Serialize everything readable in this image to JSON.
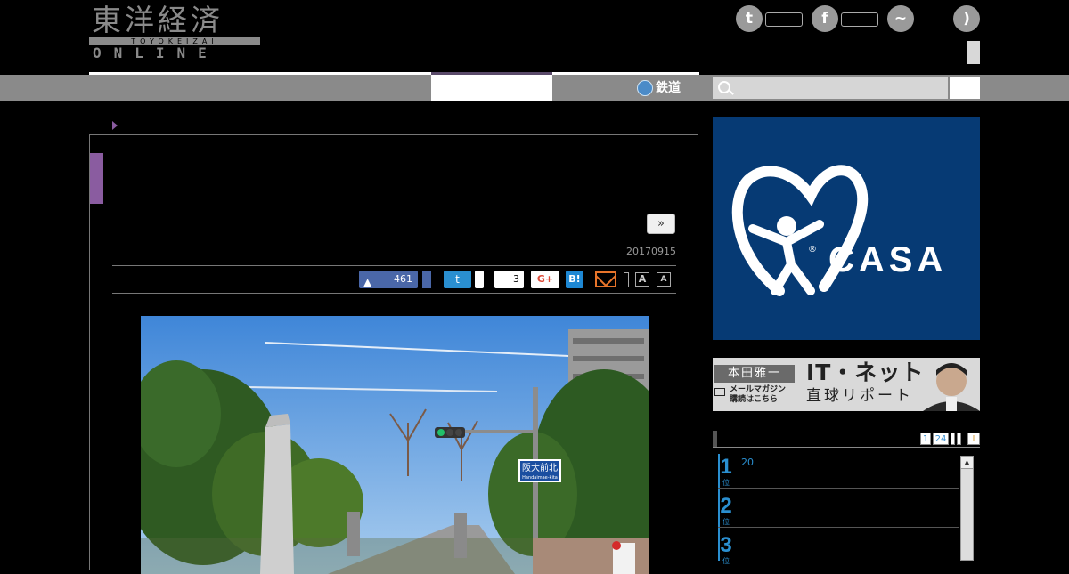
{
  "header": {
    "logo_main": "東洋経済",
    "logo_roman": "TOYOKEIZAI",
    "logo_sub": "ONLINE"
  },
  "social_top": [
    {
      "icon": "twitter-icon",
      "glyph": "t"
    },
    {
      "icon": "facebook-icon",
      "glyph": "f"
    },
    {
      "icon": "messenger-icon",
      "glyph": "~"
    },
    {
      "icon": "rss-icon",
      "glyph": ")"
    }
  ],
  "nav": {
    "railway_label": "鉄道",
    "search_placeholder": ""
  },
  "article": {
    "next_label": "»",
    "date": "20170915",
    "share": {
      "like_count": "461",
      "hatena_count": "3",
      "gplus_label": "G+",
      "hatena_label": "B!",
      "twitter_glyph": "t",
      "font_large": "A",
      "font_small": "A"
    },
    "photo": {
      "signpost_text": "阪大前北",
      "signpost_sub": "Handaimae-kita"
    }
  },
  "sidebar": {
    "ad": {
      "brand": "CASA",
      "reg": "®"
    },
    "banner": {
      "name": "本田雅一",
      "mail_line1": "メールマガジン",
      "mail_line2": "購読はこちら",
      "title": "IT・ネット",
      "subtitle": "直球リポート"
    },
    "ranking": {
      "tabs": [
        "1",
        "24",
        "",
        "",
        "I"
      ],
      "items": [
        {
          "rank": "1",
          "unit": "位",
          "text": "20"
        },
        {
          "rank": "2",
          "unit": "位",
          "text": ""
        },
        {
          "rank": "3",
          "unit": "位",
          "text": ""
        }
      ]
    }
  },
  "colors": {
    "nav_gray": "#8a8a8a",
    "accent_purple": "#8a5ca0",
    "ad_blue": "#063a74",
    "rank_blue": "#2a8fd0"
  }
}
